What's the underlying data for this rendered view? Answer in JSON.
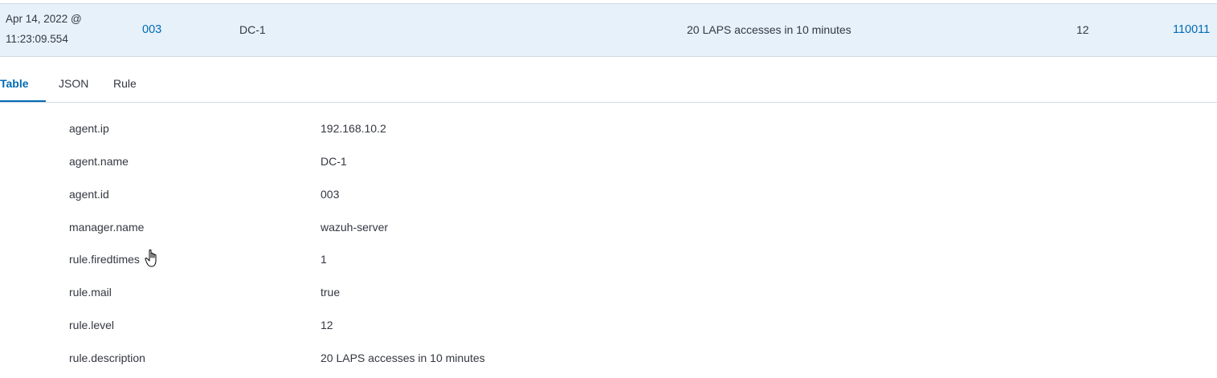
{
  "event": {
    "timestamp": "Apr 14, 2022 @ 11:23:09.554",
    "agent_id": "003",
    "agent_name": "DC-1",
    "description": "20 LAPS accesses in 10 minutes",
    "level": "12",
    "rule_id": "110011"
  },
  "tabs": [
    {
      "label": "Table",
      "active": true
    },
    {
      "label": "JSON",
      "active": false
    },
    {
      "label": "Rule",
      "active": false
    }
  ],
  "fields": [
    {
      "key": "agent.ip",
      "value": "192.168.10.2"
    },
    {
      "key": "agent.name",
      "value": "DC-1"
    },
    {
      "key": "agent.id",
      "value": "003"
    },
    {
      "key": "manager.name",
      "value": "wazuh-server"
    },
    {
      "key": "rule.firedtimes",
      "value": "1"
    },
    {
      "key": "rule.mail",
      "value": "true"
    },
    {
      "key": "rule.level",
      "value": "12"
    },
    {
      "key": "rule.description",
      "value": "20 LAPS accesses in 10 minutes"
    }
  ],
  "colors": {
    "row_highlight": "#e6f1fa",
    "link": "#006bb4",
    "text": "#343741",
    "border": "#d3dae6"
  },
  "icons": {
    "cursor": "hand-pointer-icon"
  }
}
